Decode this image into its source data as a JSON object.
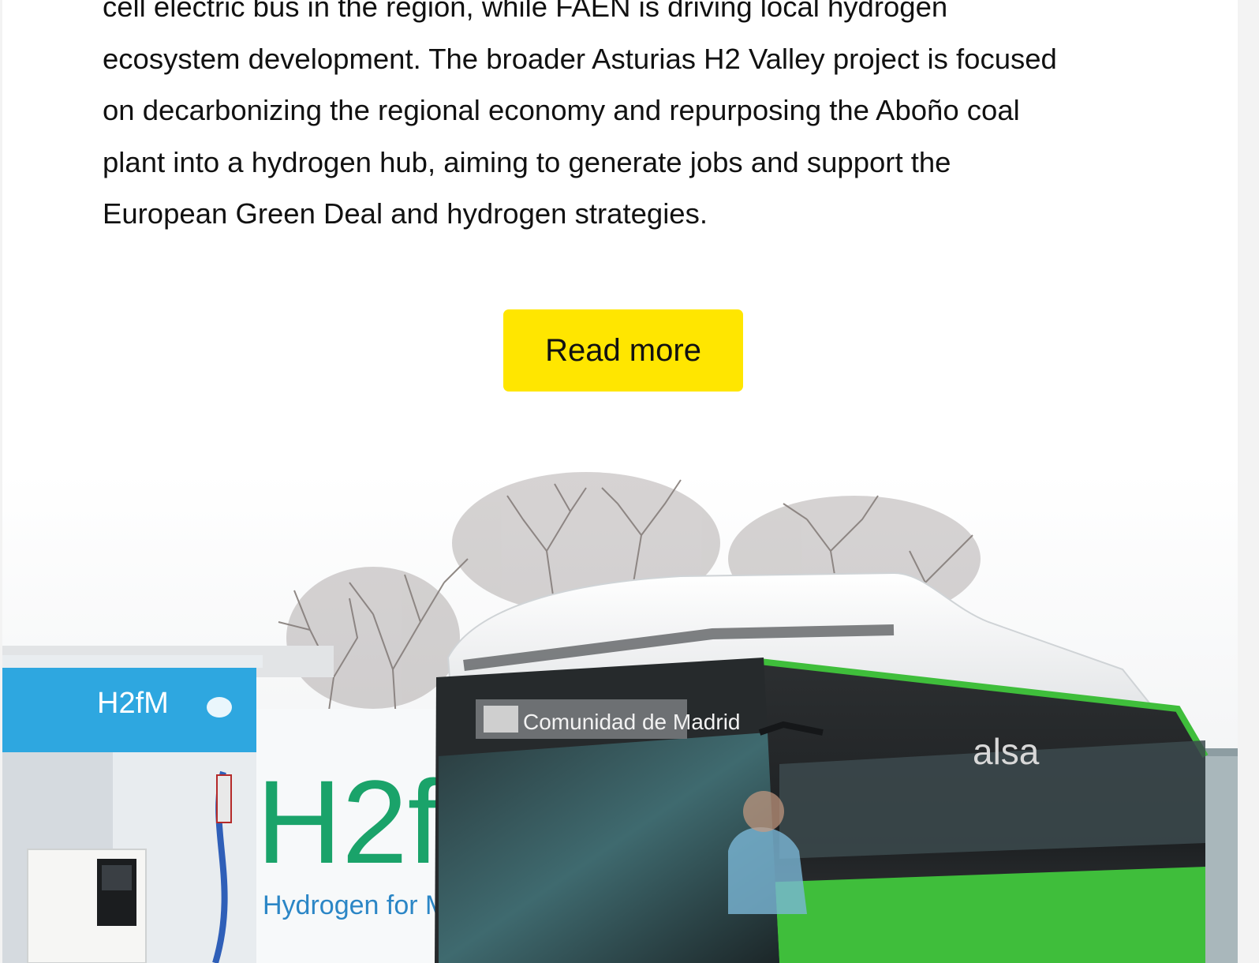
{
  "article": {
    "lines": [
      "cell electric bus in the region, while FAEN is driving local hydrogen",
      "ecosystem development. The broader Asturias H2 Valley project is focused",
      "on decarbonizing the regional economy and repurposing the Aboño coal",
      "plant into a hydrogen hub, aiming to generate jobs and support the",
      "European Green Deal and hydrogen strategies."
    ]
  },
  "cta": {
    "read_more_label": "Read more",
    "color": "#ffe600"
  },
  "photo": {
    "destination_sign": "Comunidad de Madrid",
    "operator": "alsa",
    "station_brand": "H2fM",
    "station_tagline": "Hydrogen for Mob"
  },
  "colors": {
    "bus_green": "#3fbe3b",
    "station_blue": "#2ea7e0",
    "logo_green": "#1aa36a"
  }
}
